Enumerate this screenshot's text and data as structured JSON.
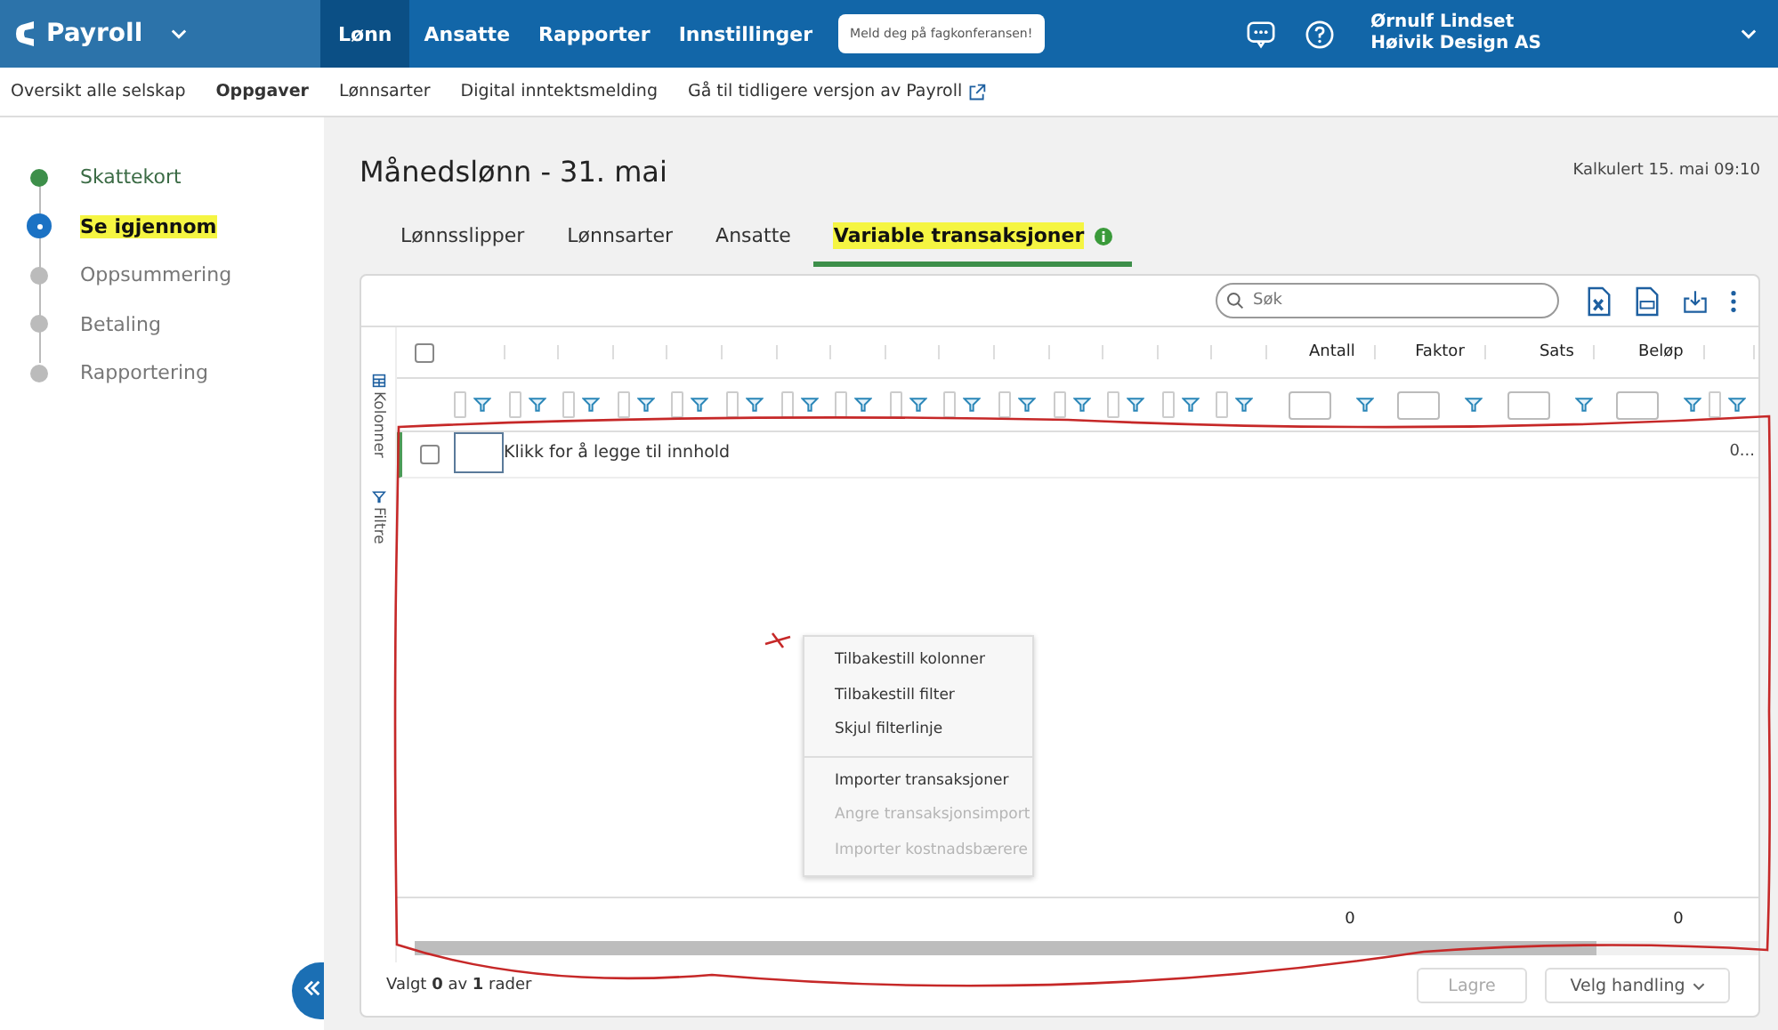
{
  "app": {
    "name": "Payroll"
  },
  "nav": [
    {
      "label": "Lønn",
      "selected": true
    },
    {
      "label": "Ansatte",
      "selected": false
    },
    {
      "label": "Rapporter",
      "selected": false
    },
    {
      "label": "Innstillinger",
      "selected": false
    }
  ],
  "banner_button": "Meld deg på fagkonferansen!",
  "user": {
    "name": "Ørnulf Lindset",
    "company": "Høivik Design AS"
  },
  "subnav": [
    {
      "label": "Oversikt alle selskap",
      "selected": false
    },
    {
      "label": "Oppgaver",
      "selected": true
    },
    {
      "label": "Lønnsarter",
      "selected": false
    },
    {
      "label": "Digital inntektsmelding",
      "selected": false
    },
    {
      "label": "Gå til tidligere versjon av Payroll",
      "selected": false,
      "external": true
    }
  ],
  "steps": [
    {
      "label": "Skattekort",
      "kind": "done",
      "highlighted": false
    },
    {
      "label": "Se igjennom",
      "kind": "current",
      "highlighted": true
    },
    {
      "label": "Oppsummering",
      "kind": "pending",
      "highlighted": false
    },
    {
      "label": "Betaling",
      "kind": "pending",
      "highlighted": false
    },
    {
      "label": "Rapportering",
      "kind": "pending",
      "highlighted": false
    }
  ],
  "page_title": "Månedslønn - 31. mai",
  "calculated": "Kalkulert 15. mai 09:10",
  "tabs": [
    {
      "label": "Lønnsslipper",
      "selected": false,
      "highlighted": false,
      "info": false
    },
    {
      "label": "Lønnsarter",
      "selected": false,
      "highlighted": false,
      "info": false
    },
    {
      "label": "Ansatte",
      "selected": false,
      "highlighted": false,
      "info": false
    },
    {
      "label": "Variable transaksjoner",
      "selected": true,
      "highlighted": true,
      "info": true
    }
  ],
  "search": {
    "placeholder": "Søk"
  },
  "side_tabs": [
    "Kolonner",
    "Filtre"
  ],
  "table": {
    "select_all_checked": false,
    "columns": [
      {
        "kind": "blank"
      },
      {
        "kind": "blank"
      },
      {
        "kind": "blank"
      },
      {
        "kind": "blank"
      },
      {
        "kind": "blank"
      },
      {
        "kind": "blank"
      },
      {
        "kind": "blank"
      },
      {
        "kind": "blank"
      },
      {
        "kind": "blank"
      },
      {
        "kind": "blank"
      },
      {
        "kind": "blank"
      },
      {
        "kind": "blank"
      },
      {
        "kind": "blank"
      },
      {
        "kind": "blank"
      },
      {
        "kind": "blank"
      },
      {
        "kind": "named",
        "label": "Antall",
        "total": "0"
      },
      {
        "kind": "named",
        "label": "Faktor"
      },
      {
        "kind": "named",
        "label": "Sats"
      },
      {
        "kind": "named",
        "label": "Beløp",
        "total": "0"
      },
      {
        "kind": "cut"
      }
    ],
    "new_row": {
      "checked": false,
      "prompt": "Klikk for å legge til innhold",
      "last_cell": "0..."
    }
  },
  "context_menu": [
    {
      "label": "Tilbakestill kolonner",
      "disabled": false,
      "separator_before": false
    },
    {
      "label": "Tilbakestill filter",
      "disabled": false,
      "separator_before": false
    },
    {
      "label": "Skjul filterlinje",
      "disabled": false,
      "separator_before": false
    },
    {
      "label": "Importer transaksjoner",
      "disabled": false,
      "separator_before": true
    },
    {
      "label": "Angre transaksjonsimport",
      "disabled": true,
      "separator_before": false
    },
    {
      "label": "Importer kostnadsbærere",
      "disabled": true,
      "separator_before": false
    }
  ],
  "footer": {
    "selection": "Valgt **0** av **1** rader",
    "buttons": [
      {
        "label": "Lagre",
        "disabled": true,
        "dropdown": false
      },
      {
        "label": "Velg handling",
        "disabled": false,
        "dropdown": true
      }
    ]
  },
  "annotation": {
    "outline": true
  }
}
